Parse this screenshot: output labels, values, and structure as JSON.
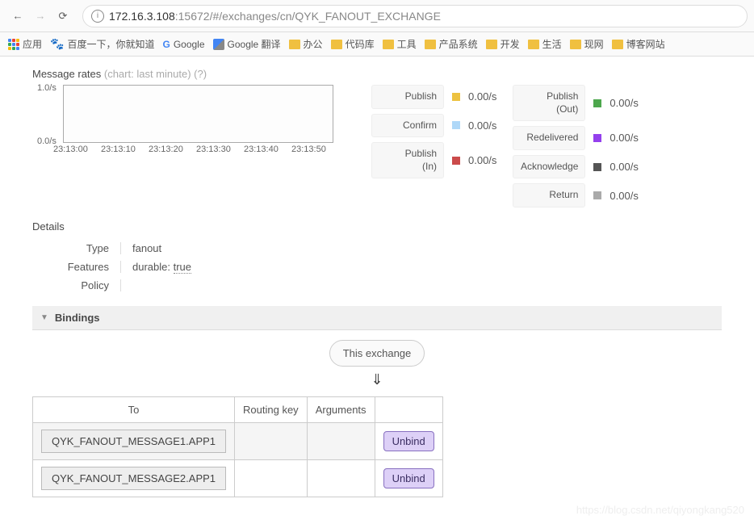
{
  "url": {
    "host": "172.16.3.108",
    "rest": ":15672/#/exchanges/cn/QYK_FANOUT_EXCHANGE"
  },
  "bookmarks": {
    "apps": "应用",
    "baidu": "百度一下，你就知道",
    "google": "Google",
    "gtranslate": "Google 翻译",
    "b1": "办公",
    "b2": "代码库",
    "b3": "工具",
    "b4": "产品系统",
    "b5": "开发",
    "b6": "生活",
    "b7": "现网",
    "b8": "博客网站"
  },
  "rates_title": "Message rates ",
  "rates_sub": "(chart: last minute) ",
  "rates_help": "(?)",
  "chart": {
    "y_top": "1.0/s",
    "y_bot": "0.0/s",
    "x": [
      "23:13:00",
      "23:13:10",
      "23:13:20",
      "23:13:30",
      "23:13:40",
      "23:13:50"
    ]
  },
  "rate_labels": {
    "publish": "Publish",
    "confirm": "Confirm",
    "publish_in_a": "Publish",
    "publish_in_b": "(In)",
    "publish_out_a": "Publish",
    "publish_out_b": "(Out)",
    "redelivered": "Redelivered",
    "acknowledge": "Acknowledge",
    "return": "Return"
  },
  "rate_values": {
    "publish": "0.00/s",
    "confirm": "0.00/s",
    "publish_in": "0.00/s",
    "publish_out": "0.00/s",
    "redelivered": "0.00/s",
    "acknowledge": "0.00/s",
    "return": "0.00/s"
  },
  "colors": {
    "publish": "#edc240",
    "confirm": "#afd8f8",
    "publish_in": "#cb4b4b",
    "publish_out": "#4da74d",
    "redelivered": "#9440ed",
    "acknowledge": "#555555",
    "return": "#aaaaaa"
  },
  "details": {
    "title": "Details",
    "type_key": "Type",
    "type_val": "fanout",
    "features_key": "Features",
    "features_val_a": "durable: ",
    "features_val_b": "true",
    "policy_key": "Policy",
    "policy_val": ""
  },
  "bindings": {
    "header": "Bindings",
    "this_exchange": "This exchange",
    "arrow": "⇓",
    "th_to": "To",
    "th_rk": "Routing key",
    "th_args": "Arguments",
    "rows": [
      {
        "to": "QYK_FANOUT_MESSAGE1.APP1",
        "rk": "",
        "args": "",
        "btn": "Unbind"
      },
      {
        "to": "QYK_FANOUT_MESSAGE2.APP1",
        "rk": "",
        "args": "",
        "btn": "Unbind"
      }
    ]
  },
  "watermark": "https://blog.csdn.net/qiyongkang520"
}
